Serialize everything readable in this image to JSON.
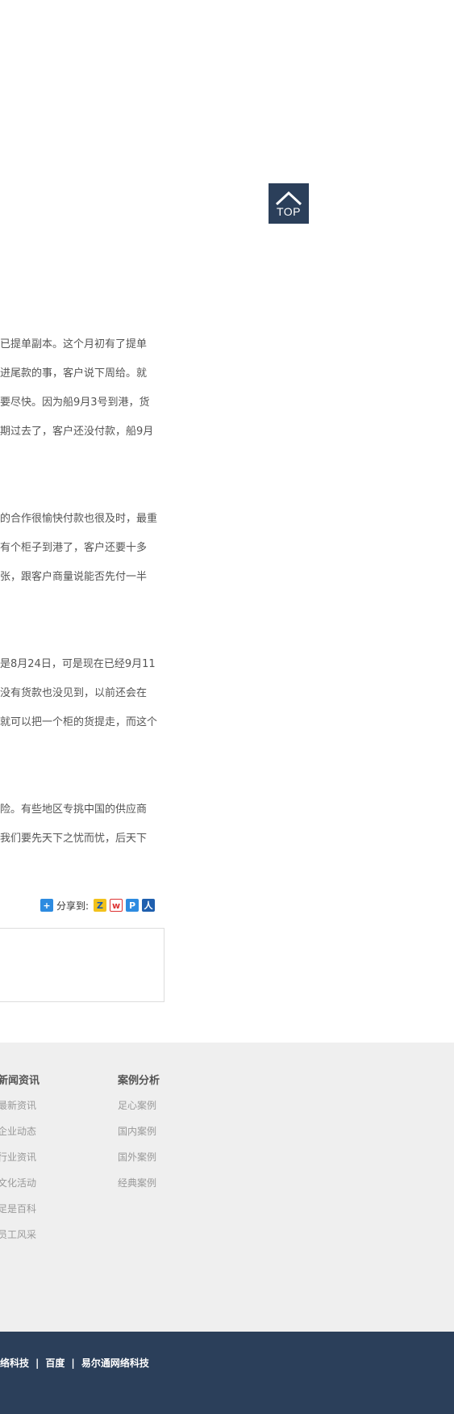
{
  "top_button": {
    "label": "TOP"
  },
  "article": {
    "lines": [
      "已提单副本。这个月初有了提单",
      "进尾款的事，客户说下周给。就",
      "要尽快。因为船9月3号到港，货",
      "期过去了，客户还没付款，船9月",
      "的合作很愉快付款也很及时，最重",
      "有个柜子到港了，客户还要十多",
      "张，跟客户商量说能否先付一半",
      "是8月24日，可是现在已经9月11",
      "没有货款也没见到，以前还会在",
      "就可以把一个柜的货提走，而这个",
      "险。有些地区专挑中国的供应商",
      "我们要先天下之忧而忧，后天下"
    ]
  },
  "share": {
    "label": "分享到:",
    "icons": [
      "qzone-icon",
      "weibo-icon",
      "pengyou-icon",
      "renren-icon"
    ]
  },
  "footer": {
    "news": {
      "title": "新闻资讯",
      "items": [
        "最新资讯",
        "企业动态",
        "行业资讯",
        "文化活动",
        "足是百科",
        "员工风采"
      ]
    },
    "cases": {
      "title": "案例分析",
      "items": [
        "足心案例",
        "国内案例",
        "国外案例",
        "经典案例"
      ]
    }
  },
  "bottom": {
    "links": [
      "络科技",
      "百度",
      "易尔通网络科技"
    ],
    "separator": "|"
  },
  "colors": {
    "footer_bg": "#efefef",
    "bottom_bg": "#2b3f5a",
    "accent": "#2b3f5a"
  }
}
